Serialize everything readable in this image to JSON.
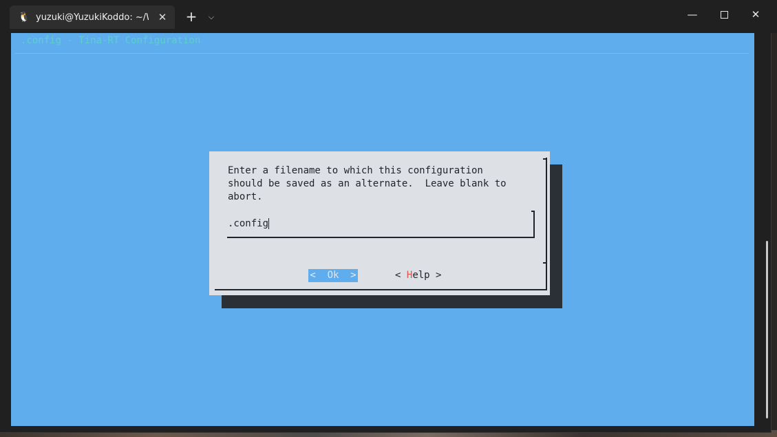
{
  "window": {
    "tab_title": "yuzuki@YuzukiKoddo: ~/Work",
    "tab_icon": "linux-penguin-icon",
    "new_tab_icon": "+",
    "dropdown_icon": "⌵",
    "close_tab_icon": "✕",
    "minimize_icon": "—",
    "close_icon": "✕"
  },
  "terminal": {
    "backtitle": ".config - Tina-RT Configuration",
    "background_color": "#60adee"
  },
  "dialog": {
    "prompt_lines": [
      "Enter a filename to which this configuration",
      "should be saved as an alternate.  Leave blank to",
      "abort."
    ],
    "input_value": ".config",
    "ok_button": {
      "left": "<",
      "label": "Ok",
      "right": ">"
    },
    "help_button": {
      "left": "<",
      "hotkey": "H",
      "rest": "elp",
      "right": ">"
    }
  }
}
